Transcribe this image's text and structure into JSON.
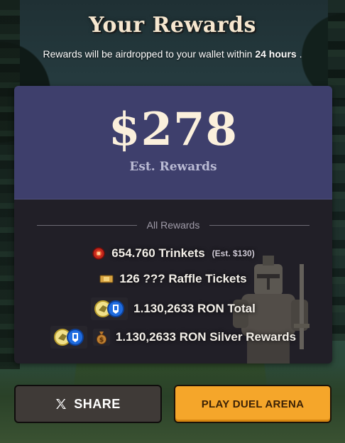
{
  "header": {
    "title": "Your Rewards",
    "subtitle_prefix": "Rewards will be airdropped to your wallet within ",
    "subtitle_highlight": "24 hours",
    "subtitle_suffix": " ."
  },
  "summary": {
    "amount": "$278",
    "label": "Est. Rewards"
  },
  "rewards": {
    "section_label": "All Rewards",
    "items": [
      {
        "icon": "trinket-icon",
        "text": "654.760 Trinkets",
        "note": "(Est. $130)"
      },
      {
        "icon": "raffle-ticket-icon",
        "text": "126 ??? Raffle Tickets"
      },
      {
        "icon": "ron-token-pair-icon",
        "text": "1.130,2633 RON Total"
      },
      {
        "icon": "money-bag-icon",
        "text": "1.130,2633 RON Silver Rewards"
      }
    ]
  },
  "actions": {
    "share_label": "SHARE",
    "play_label": "PLAY DUEL ARENA"
  },
  "colors": {
    "card_top": "#3e3f6c",
    "card_bottom": "#211f27",
    "play_button": "#f5a62a",
    "share_button": "#3f3a37",
    "title": "#f6e7cf"
  }
}
